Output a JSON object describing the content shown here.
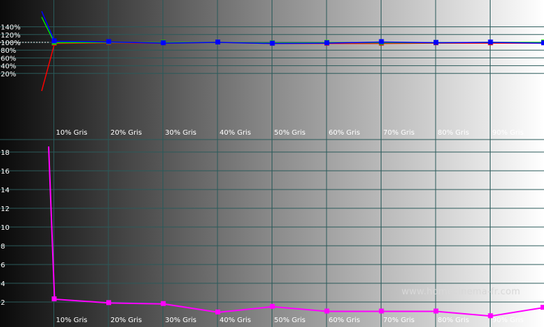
{
  "chart_data": [
    {
      "type": "line",
      "categories": [
        "",
        "10% Gris",
        "20% Gris",
        "30% Gris",
        "40% Gris",
        "50% Gris",
        "60% Gris",
        "70% Gris",
        "80% Gris",
        "90% Gris",
        ""
      ],
      "x": [
        0,
        10,
        20,
        30,
        40,
        50,
        60,
        70,
        80,
        90,
        100
      ],
      "ylim": [
        0,
        150
      ],
      "yticks": [
        "20%",
        "40%",
        "60%",
        "80%",
        "100%",
        "120%",
        "140%"
      ],
      "reference_line": 100,
      "series": [
        {
          "color": "#ff0000",
          "values": [
            -25,
            97,
            99,
            98,
            100,
            97,
            97,
            97,
            98,
            98,
            98
          ]
        },
        {
          "color": "#00e000",
          "values": [
            165,
            99,
            100,
            99,
            100,
            98,
            99,
            99,
            99,
            100,
            100
          ]
        },
        {
          "color": "#0000ff",
          "values": [
            180,
            103,
            101,
            98,
            100,
            97,
            98,
            101,
            99,
            100,
            98
          ]
        }
      ]
    },
    {
      "type": "line",
      "categories": [
        "",
        "10% Gris",
        "20% Gris",
        "30% Gris",
        "40% Gris",
        "50% Gris",
        "60% Gris",
        "70% Gris",
        "80% Gris",
        "90% Gris",
        ""
      ],
      "x": [
        0,
        10,
        20,
        30,
        40,
        50,
        60,
        70,
        80,
        90,
        100
      ],
      "ylim": [
        0,
        20
      ],
      "yticks": [
        "2",
        "4",
        "6",
        "8",
        "10",
        "12",
        "14",
        "16",
        "18"
      ],
      "series": [
        {
          "color": "#ff00ff",
          "values": [
            18.6,
            2.3,
            1.9,
            1.8,
            0.9,
            1.5,
            1.0,
            1.0,
            1.0,
            0.5,
            1.4
          ]
        }
      ]
    }
  ],
  "watermark": "www.homecinema-fr.com"
}
